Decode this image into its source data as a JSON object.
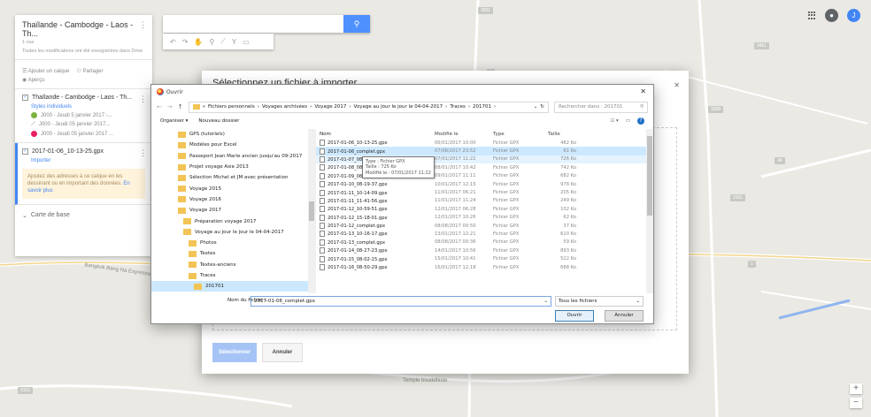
{
  "map": {
    "labels": [
      "Temple bouddhiste",
      "Bangkok Bang Na Expressway"
    ],
    "shields": [
      "3901",
      "3451",
      "9",
      "3268",
      "34",
      "3101",
      "1",
      "3151"
    ]
  },
  "panel": {
    "title": "Thaïlande - Cambodge - Laos - Th...",
    "views": "1 vue",
    "saved": "Toutes les modifications ont été enregistrées dans Drive",
    "add_layer": "Ajouter un calque",
    "share": "Partager",
    "preview": "Aperçu",
    "layer1": {
      "name": "Thaïlande - Cambodge - Laos - Th...",
      "style": "Styles individuels",
      "items": [
        "J000 - Jeudi 5 janvier 2017 -...",
        "J000 - Jeudi 05 janvier 2017...",
        "J000 - Jeudi 05 janvier 2017 ..."
      ]
    },
    "layer2": {
      "name": "2017-01-06_10-13-25.gpx",
      "import": "Importer",
      "hint": "Ajoutez des adresses à ce calque en les dessinant ou en important des données.",
      "hint_link": "En savoir plus"
    },
    "basemap": "Carte de base"
  },
  "search": {
    "placeholder": ""
  },
  "import_dialog": {
    "title": "Sélectionnez un fichier à importer",
    "select": "Sélectionner",
    "cancel": "Annuler"
  },
  "open_dialog": {
    "title": "Ouvrir",
    "path": [
      "Fichiers personnels",
      "Voyages archivées",
      "Voyage 2017",
      "Voyage au jour le jour le 04-04-2017",
      "Traces",
      "201701"
    ],
    "search_placeholder": "Rechercher dans : 201701",
    "organize": "Organiser ▾",
    "new_folder": "Nouveau dossier",
    "tree": [
      "GPS (tutoriels)",
      "Modèles pour Excel",
      "Passeport Jean Marie ancien jusqu'au 09-2017",
      "Projet voyage Asie 2013",
      "Sélection Michel et JM avec présentation",
      "Voyage 2015",
      "Voyage 2016",
      "Voyage 2017",
      "Préparation voyage 2017",
      "Voyage au jour le jour le 04-04-2017",
      "Photos",
      "Textes",
      "Textes-anciens",
      "Traces",
      "201701"
    ],
    "columns": {
      "name": "Nom",
      "date": "Modifié le",
      "type": "Type",
      "size": "Taille"
    },
    "files": [
      {
        "name": "2017-01-06_10-13-25.gpx",
        "date": "06/01/2017 10:00",
        "type": "Fichier GPX",
        "size": "482 Ko"
      },
      {
        "name": "2017-01-06_complet.gpx",
        "date": "07/08/2017 23:52",
        "type": "Fichier GPX",
        "size": "61 Ko"
      },
      {
        "name": "2017-01-07_08-31-31.gpx",
        "date": "07/01/2017 11:22",
        "type": "Fichier GPX",
        "size": "726 Ko"
      },
      {
        "name": "2017-01-08_08-",
        "date": "08/01/2017 10:42",
        "type": "Fichier GPX",
        "size": "742 Ko"
      },
      {
        "name": "2017-01-09_08-",
        "date": "09/01/2017 11:11",
        "type": "Fichier GPX",
        "size": "682 Ko"
      },
      {
        "name": "2017-01-10_08-19-37.gpx",
        "date": "10/01/2017 12:15",
        "type": "Fichier GPX",
        "size": "978 Ko"
      },
      {
        "name": "2017-01-11_10-14-09.gpx",
        "date": "11/01/2017 06:21",
        "type": "Fichier GPX",
        "size": "205 Ko"
      },
      {
        "name": "2017-01-11_11-41-56.gpx",
        "date": "11/01/2017 11:24",
        "type": "Fichier GPX",
        "size": "249 Ko"
      },
      {
        "name": "2017-01-12_10-59-51.gpx",
        "date": "12/01/2017 06:28",
        "type": "Fichier GPX",
        "size": "102 Ko"
      },
      {
        "name": "2017-01-12_15-18-01.gpx",
        "date": "12/01/2017 10:26",
        "type": "Fichier GPX",
        "size": "62 Ko"
      },
      {
        "name": "2017-01-12_complet.gpx",
        "date": "08/08/2017 00:50",
        "type": "Fichier GPX",
        "size": "37 Ko"
      },
      {
        "name": "2017-01-13_10-16-17.gpx",
        "date": "13/01/2017 12:21",
        "type": "Fichier GPX",
        "size": "610 Ko"
      },
      {
        "name": "2017-01-13_complet.gpx",
        "date": "08/08/2017 00:36",
        "type": "Fichier GPX",
        "size": "59 Ko"
      },
      {
        "name": "2017-01-14_08-27-23.gpx",
        "date": "14/01/2017 10:56",
        "type": "Fichier GPX",
        "size": "893 Ko"
      },
      {
        "name": "2017-01-15_08-02-15.gpx",
        "date": "15/01/2017 10:41",
        "type": "Fichier GPX",
        "size": "522 Ko"
      },
      {
        "name": "2017-01-16_08-50-29.gpx",
        "date": "16/01/2017 12:18",
        "type": "Fichier GPX",
        "size": "688 Ko"
      }
    ],
    "tooltip": {
      "type": "Type : Fichier GPX",
      "size": "Taille : 725 Ko",
      "modified": "Modifié le : 07/01/2017 11:22"
    },
    "filename_label": "Nom du fichier :",
    "filename": "2017-01-06_complet.gpx",
    "filetype": "Tous les fichiers",
    "ok": "Ouvrir",
    "cancel": "Annuler"
  }
}
